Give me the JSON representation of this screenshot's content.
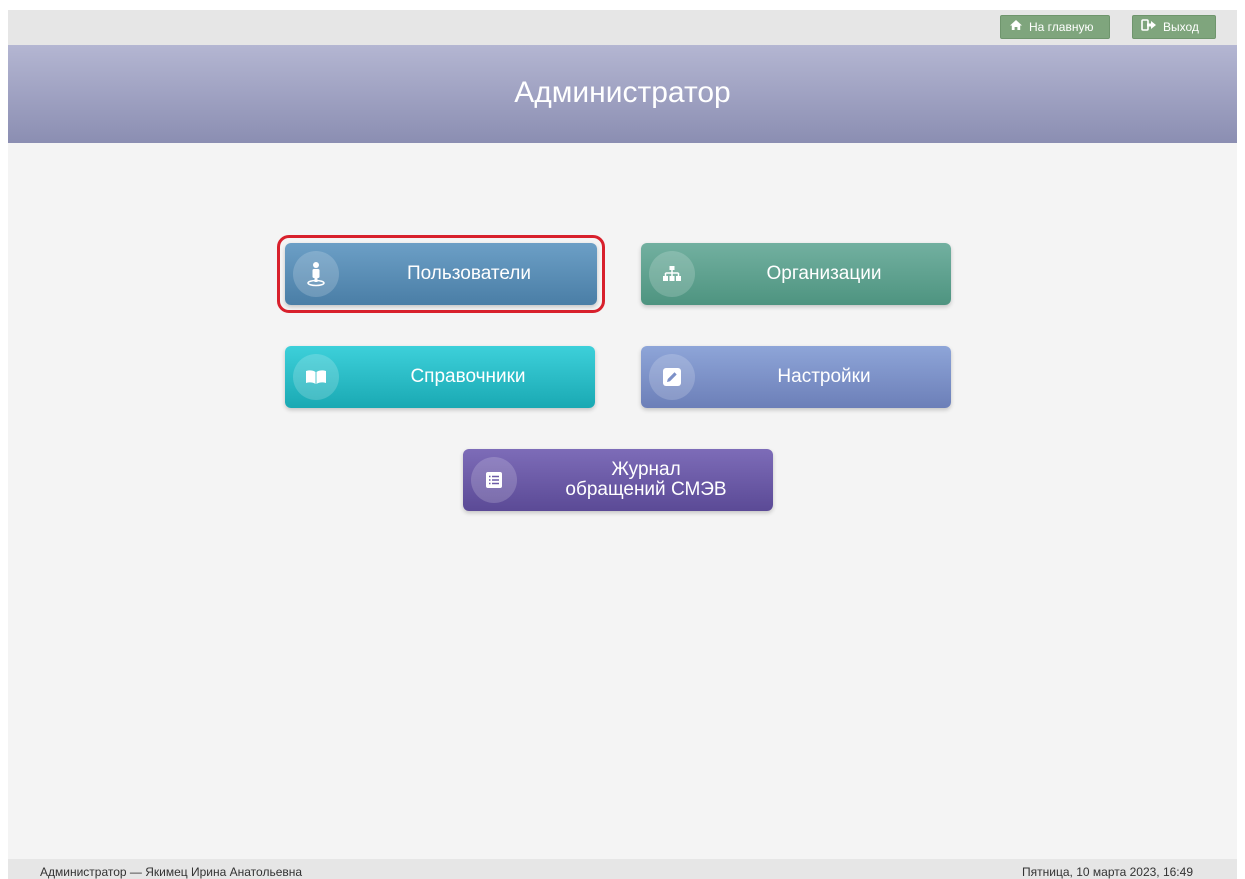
{
  "topbar": {
    "home_label": "На главную",
    "logout_label": "Выход",
    "button_color": "#7fa57d"
  },
  "header": {
    "title": "Администратор"
  },
  "tiles": [
    {
      "label": "Пользователи",
      "icon": "user-icon",
      "color": "#5b8fb5",
      "highlighted": true
    },
    {
      "label": "Организации",
      "icon": "sitemap-icon",
      "color": "#5fa390"
    },
    {
      "label": "Справочники",
      "icon": "book-icon",
      "color": "#2bbcc6"
    },
    {
      "label": "Настройки",
      "icon": "edit-icon",
      "color": "#7d91c8"
    },
    {
      "label": "Журнал обращений СМЭВ",
      "icon": "list-icon",
      "color": "#6c5ba7"
    }
  ],
  "highlight_color": "#d8202c",
  "footer": {
    "user": "Администратор — Якимец Ирина Анатольевна",
    "datetime": "Пятница, 10 марта 2023, 16:49"
  }
}
